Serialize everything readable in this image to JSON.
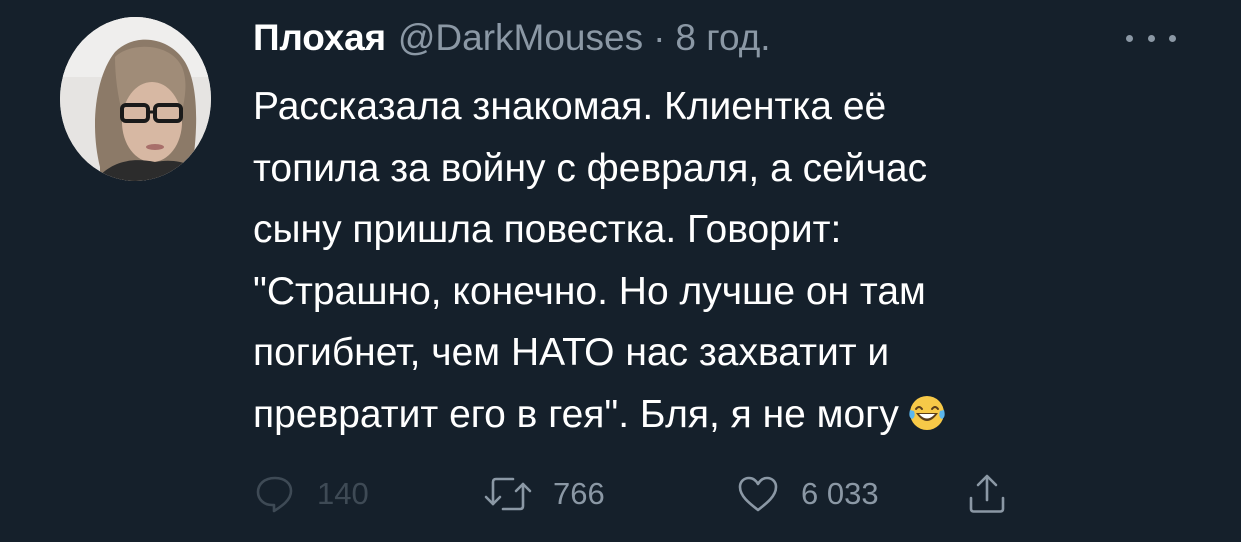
{
  "tweet": {
    "display_name": "Плохая",
    "handle": "@DarkMouses",
    "separator": "·",
    "time": "8 год.",
    "text_lines": [
      "Рассказала знакомая. Клиентка её",
      "топила за войну с февраля, а сейчас",
      "сыну пришла повестка. Говорит:",
      "\"Страшно, конечно. Но лучше он там",
      "погибнет, чем НАТО нас захватит и",
      "превратит его в гея\". Бля, я не могу"
    ],
    "emoji": "face-with-tears-of-joy",
    "counts": {
      "replies": "140",
      "retweets": "766",
      "likes": "6 033"
    }
  },
  "colors": {
    "background": "#15202b",
    "primary_text": "#ffffff",
    "secondary_text": "#8b98a5"
  },
  "icons": {
    "more": "more-horizontal-icon",
    "reply": "reply-icon",
    "retweet": "retweet-icon",
    "like": "heart-icon",
    "share": "share-icon"
  }
}
